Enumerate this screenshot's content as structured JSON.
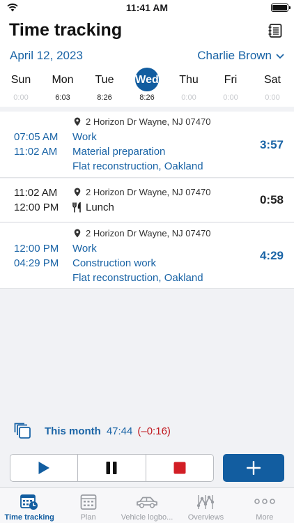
{
  "status_bar": {
    "time": "11:41 AM"
  },
  "header": {
    "title": "Time tracking"
  },
  "date_row": {
    "date": "April 12, 2023",
    "user": "Charlie Brown"
  },
  "week": [
    {
      "name": "Sun",
      "hours": "0:00"
    },
    {
      "name": "Mon",
      "hours": "6:03"
    },
    {
      "name": "Tue",
      "hours": "8:26"
    },
    {
      "name": "Wed",
      "hours": "8:26"
    },
    {
      "name": "Thu",
      "hours": "0:00"
    },
    {
      "name": "Fri",
      "hours": "0:00"
    },
    {
      "name": "Sat",
      "hours": "0:00"
    }
  ],
  "selected_day": "Wed",
  "entries": [
    {
      "location": "2 Horizon Dr Wayne, NJ  07470",
      "start": "07:05 AM",
      "end": "11:02 AM",
      "type": "Work",
      "activity": "Material preparation",
      "project": "Flat reconstruction, Oakland",
      "duration": "3:57"
    },
    {
      "location": "2 Horizon Dr Wayne, NJ  07470",
      "start": "11:02 AM",
      "end": "12:00 PM",
      "type": "Lunch",
      "duration": "0:58"
    },
    {
      "location": "2 Horizon Dr Wayne, NJ  07470",
      "start": "12:00 PM",
      "end": "04:29 PM",
      "type": "Work",
      "activity": "Construction work",
      "project": "Flat reconstruction, Oakland",
      "duration": "4:29"
    }
  ],
  "summary": {
    "label": "This month",
    "value": "47:44",
    "diff": "(–0:16)"
  },
  "colors": {
    "accent": "#125da0",
    "link": "#1a64a6",
    "negative": "#c0171d",
    "stop": "#d21e25"
  },
  "tabs": [
    {
      "label": "Time tracking",
      "icon": "time-tracking-icon",
      "active": true
    },
    {
      "label": "Plan",
      "icon": "calendar-icon"
    },
    {
      "label": "Vehicle logbo...",
      "icon": "car-icon"
    },
    {
      "label": "Overviews",
      "icon": "overviews-icon"
    },
    {
      "label": "More",
      "icon": "more-icon"
    }
  ]
}
